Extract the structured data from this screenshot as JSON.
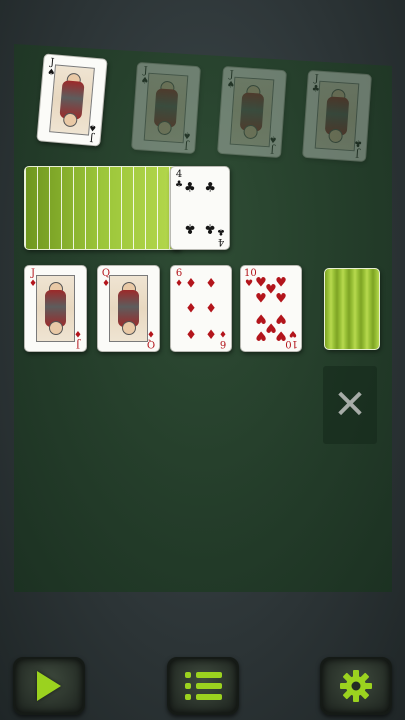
{
  "colors": {
    "felt": "#2b4731",
    "accent_green": "#9bd21f",
    "card_back": "#97bf35",
    "red_suit": "#b3151c",
    "black_suit": "#161616"
  },
  "foundations": [
    {
      "rank": "J",
      "suit": "♠",
      "color": "black",
      "dimmed": false
    },
    {
      "rank": "J",
      "suit": "♠",
      "color": "black",
      "dimmed": true
    },
    {
      "rank": "J",
      "suit": "♠",
      "color": "black",
      "dimmed": true
    },
    {
      "rank": "J",
      "suit": "♣",
      "color": "black",
      "dimmed": true
    }
  ],
  "stock_top": {
    "rank": "4",
    "suit": "♣",
    "color": "black"
  },
  "tableau": [
    {
      "rank": "J",
      "suit": "♦",
      "color": "red"
    },
    {
      "rank": "Q",
      "suit": "♦",
      "color": "red"
    },
    {
      "rank": "6",
      "suit": "♦",
      "color": "red"
    },
    {
      "rank": "10",
      "suit": "♥",
      "color": "red"
    }
  ],
  "discard_slot": {
    "icon": "close-icon",
    "glyph": "✕"
  },
  "toolbar": {
    "play_icon": "play-icon",
    "menu_icon": "menu-icon",
    "settings_icon": "gear-icon"
  }
}
